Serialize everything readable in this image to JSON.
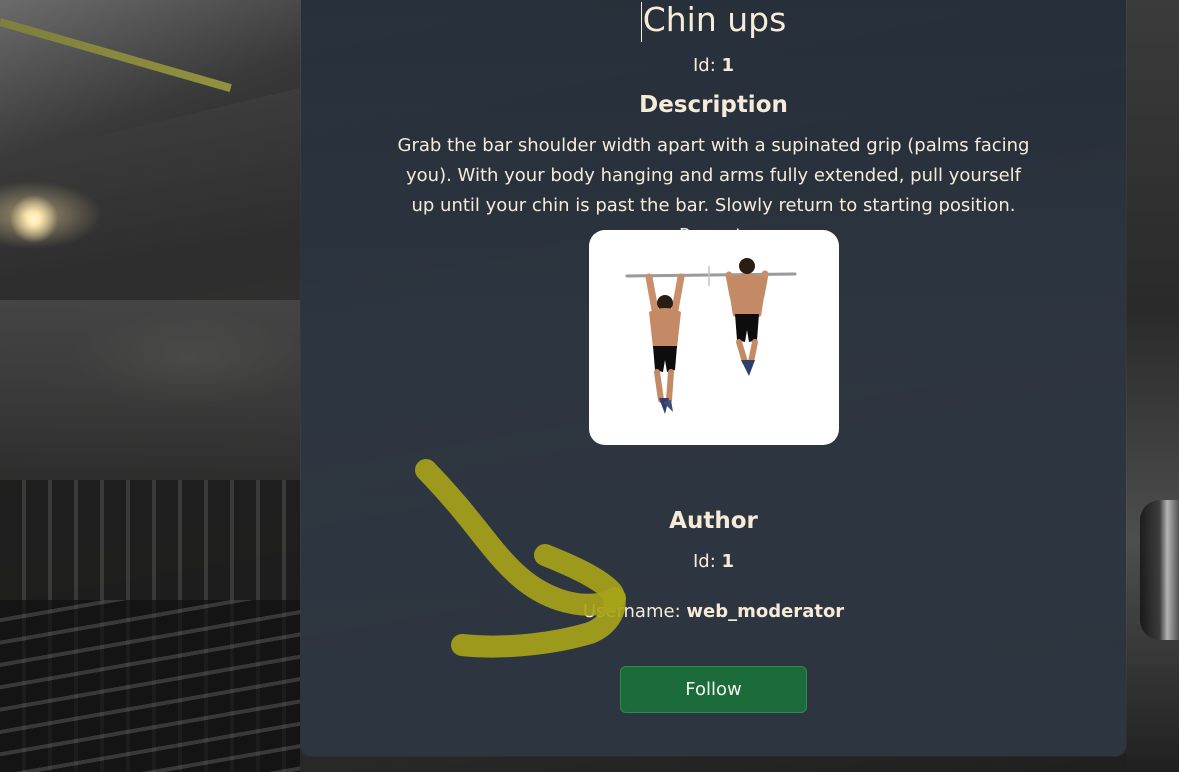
{
  "exercise": {
    "title": "Chin ups",
    "id_label": "Id:",
    "id_value": "1",
    "description_heading": "Description",
    "description": "Grab the bar shoulder width apart with a supinated grip (palms facing you). With your body hanging and arms fully extended, pull yourself up until your chin is past the bar. Slowly return to starting position. Repeat."
  },
  "author": {
    "heading": "Author",
    "id_label": "Id:",
    "id_value": "1",
    "username_label": "Username:",
    "username_value": "web_moderator"
  },
  "actions": {
    "follow_label": "Follow"
  },
  "colors": {
    "card_bg": "#242e3a",
    "text": "#f6ebd8",
    "button_bg": "#1c6b3a",
    "annotation": "#a8a41a"
  }
}
